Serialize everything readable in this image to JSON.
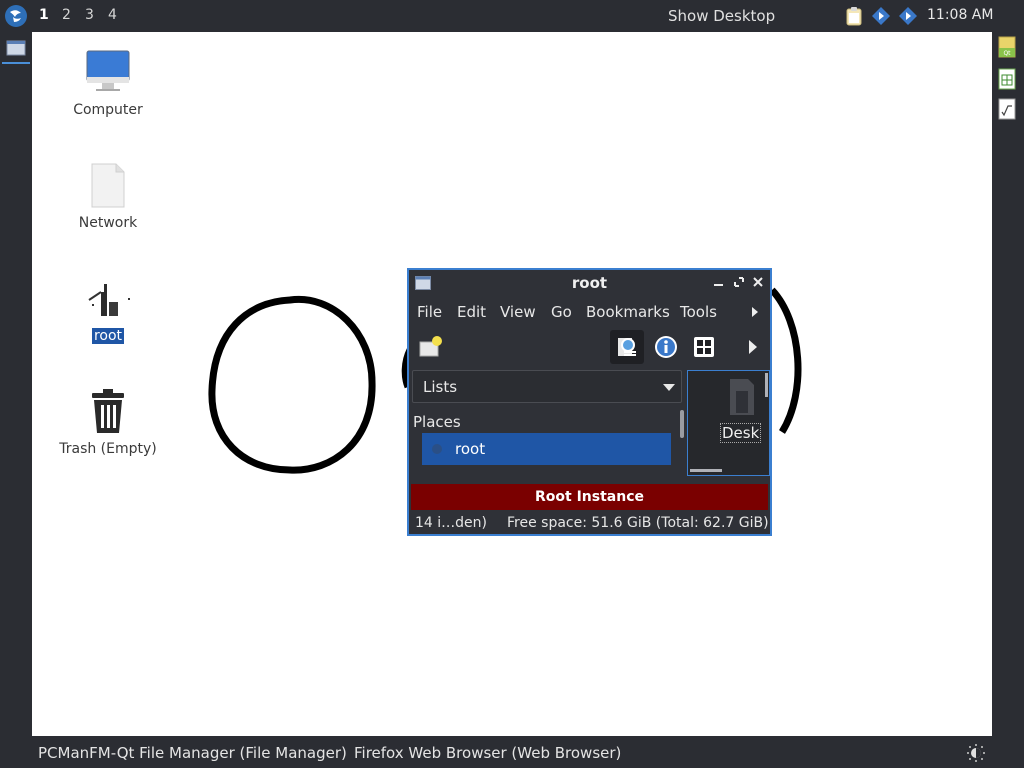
{
  "top_panel": {
    "workspaces": [
      "1",
      "2",
      "3",
      "4"
    ],
    "active_workspace": "1",
    "show_desktop_label": "Show Desktop",
    "clock": "11:08 AM",
    "tray_icons": [
      "clipboard-icon",
      "network-icon",
      "network-icon"
    ]
  },
  "right_panel": {
    "icons": [
      "qt-app-icon",
      "spreadsheet-icon",
      "formula-icon"
    ]
  },
  "desktop": {
    "items": [
      {
        "label": "Computer",
        "icon": "computer-icon",
        "selected": false
      },
      {
        "label": "Network",
        "icon": "network-file-icon",
        "selected": false
      },
      {
        "label": "root",
        "icon": "home-folder-icon",
        "selected": true
      },
      {
        "label": "Trash (Empty)",
        "icon": "trash-icon",
        "selected": false
      }
    ]
  },
  "file_manager": {
    "title": "root",
    "menu": [
      "File",
      "Edit",
      "View",
      "Go",
      "Bookmarks",
      "Tools"
    ],
    "toolbar": {
      "buttons": [
        "new-folder-icon",
        "detail-view-icon",
        "info-icon",
        "icon-view-icon",
        "more-arrow-icon"
      ]
    },
    "side_pane_mode": "Lists",
    "places_title": "Places",
    "places": [
      {
        "label": "root",
        "selected": true
      }
    ],
    "view_items": [
      {
        "label": "Desk"
      }
    ],
    "banner": "Root Instance",
    "status": {
      "items": "14 i…den)",
      "free_space": "Free space: 51.6 GiB (Total: 62.7 GiB)"
    }
  },
  "taskbar": {
    "tasks": [
      "PCManFM-Qt File Manager (File Manager)",
      "Firefox Web Browser (Web Browser)"
    ]
  }
}
